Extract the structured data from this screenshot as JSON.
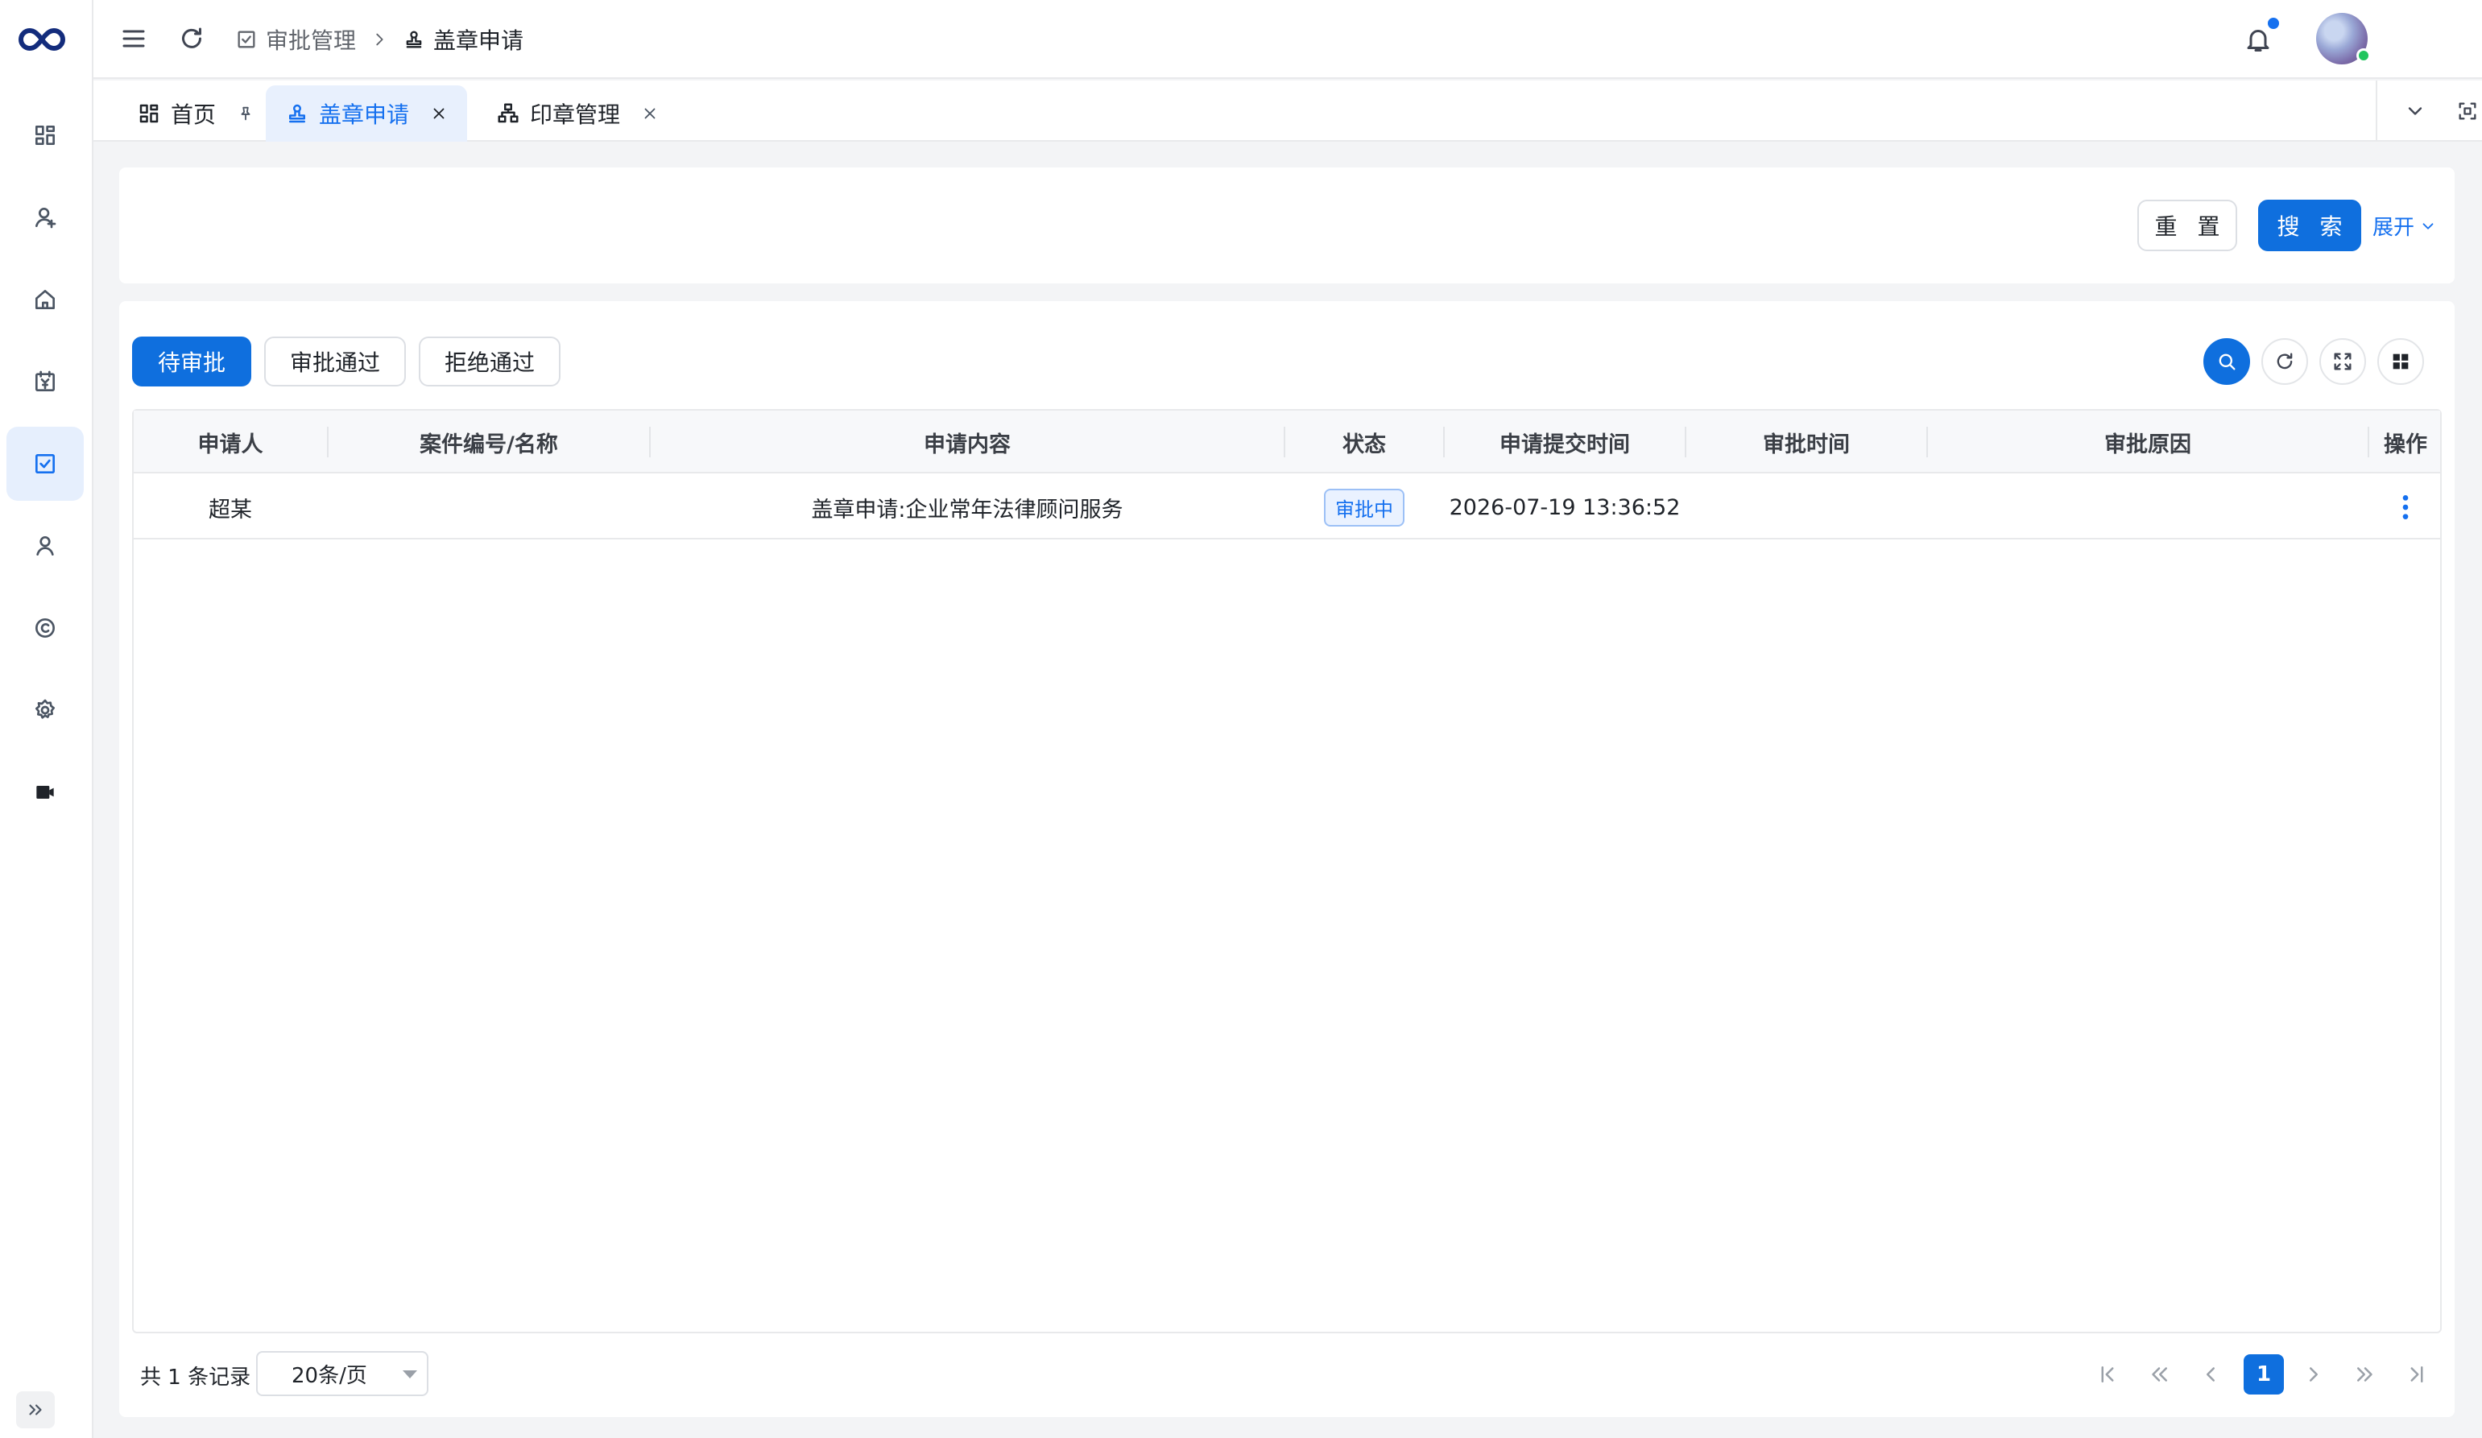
{
  "breadcrumb": {
    "parent": "审批管理",
    "current": "盖章申请"
  },
  "tabs": [
    {
      "label": "首页"
    },
    {
      "label": "盖章申请"
    },
    {
      "label": "印章管理"
    }
  ],
  "search_panel": {
    "reset_label": "重 置",
    "search_label": "搜 索",
    "expand_label": "展开"
  },
  "status_tabs": [
    {
      "label": "待审批",
      "active": true
    },
    {
      "label": "审批通过",
      "active": false
    },
    {
      "label": "拒绝通过",
      "active": false
    }
  ],
  "table": {
    "columns": [
      "申请人",
      "案件编号/名称",
      "申请内容",
      "状态",
      "申请提交时间",
      "审批时间",
      "审批原因",
      "操作"
    ],
    "rows": [
      {
        "applicant": "超某",
        "case": "",
        "content": "盖章申请:企业常年法律顾问服务",
        "status": "审批中",
        "submit_time": "2026-07-19 13:36:52",
        "approve_time": "",
        "reason": ""
      }
    ]
  },
  "pagination": {
    "total_text": "共 1 条记录",
    "page_size": "20条/页",
    "current_page": "1"
  },
  "colors": {
    "primary": "#0f6fde",
    "accent": "#1570ef",
    "status_tag_bg": "#eaf2ff"
  }
}
